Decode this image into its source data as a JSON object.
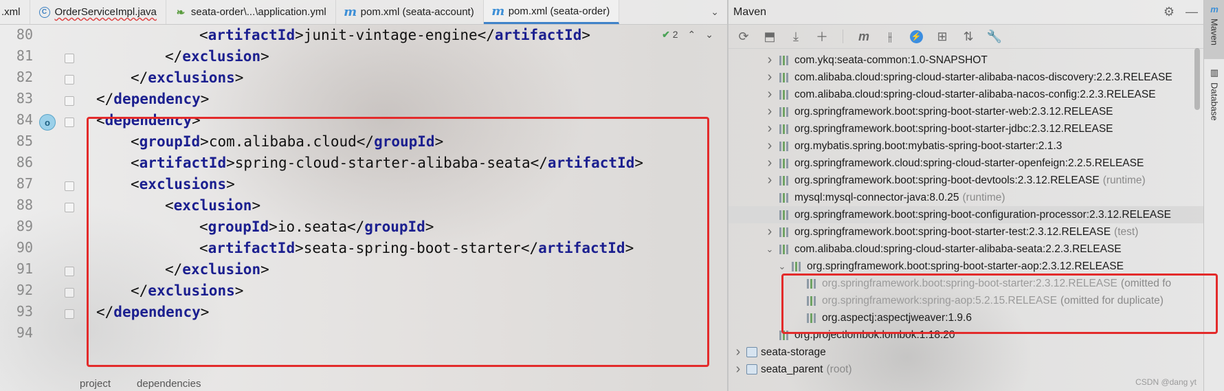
{
  "tabs": [
    {
      "label": ".xml",
      "icon": "none",
      "active": false
    },
    {
      "label": "OrderServiceImpl.java",
      "icon": "c",
      "active": false
    },
    {
      "label": "seata-order\\...\\application.yml",
      "icon": "leaf",
      "active": false
    },
    {
      "label": "pom.xml (seata-account)",
      "icon": "m",
      "active": false
    },
    {
      "label": "pom.xml (seata-order)",
      "icon": "m",
      "active": true
    }
  ],
  "editor": {
    "inspection_count": "2",
    "line_numbers": [
      "80",
      "81",
      "82",
      "83",
      "84",
      "85",
      "86",
      "87",
      "88",
      "89",
      "90",
      "91",
      "92",
      "93",
      "94"
    ],
    "lines": [
      {
        "indent": 3,
        "open": "<",
        "tag": "artifactId",
        "text": "junit-vintage-engine",
        "close": "artifactId"
      },
      {
        "indent": 2,
        "raw_prefix": "</",
        "tag": "exclusion",
        "raw_suffix": ">"
      },
      {
        "indent": 1,
        "raw_prefix": "</",
        "tag": "exclusions",
        "raw_suffix": ">"
      },
      {
        "indent": 0,
        "raw_prefix": "</",
        "tag": "dependency",
        "raw_suffix": ">"
      },
      {
        "indent": 0,
        "raw_prefix": "<",
        "tag": "dependency",
        "raw_suffix": ">"
      },
      {
        "indent": 1,
        "open": "<",
        "tag": "groupId",
        "text": "com.alibaba.cloud",
        "close": "groupId"
      },
      {
        "indent": 1,
        "open": "<",
        "tag": "artifactId",
        "text": "spring-cloud-starter-alibaba-seata",
        "close": "artifactId"
      },
      {
        "indent": 1,
        "raw_prefix": "<",
        "tag": "exclusions",
        "raw_suffix": ">"
      },
      {
        "indent": 2,
        "raw_prefix": "<",
        "tag": "exclusion",
        "raw_suffix": ">"
      },
      {
        "indent": 3,
        "open": "<",
        "tag": "groupId",
        "text": "io.seata",
        "close": "groupId"
      },
      {
        "indent": 3,
        "open": "<",
        "tag": "artifactId",
        "text": "seata-spring-boot-starter",
        "close": "artifactId"
      },
      {
        "indent": 2,
        "raw_prefix": "</",
        "tag": "exclusion",
        "raw_suffix": ">"
      },
      {
        "indent": 1,
        "raw_prefix": "</",
        "tag": "exclusions",
        "raw_suffix": ">"
      },
      {
        "indent": 0,
        "raw_prefix": "</",
        "tag": "dependency",
        "raw_suffix": ">"
      }
    ],
    "breadcrumb": [
      "project",
      "dependencies"
    ]
  },
  "maven": {
    "title": "Maven",
    "tree": [
      {
        "label": "com.ykq:seata-common:1.0-SNAPSHOT",
        "suffix": "",
        "level": 2,
        "arrow": "right",
        "icon": "lib"
      },
      {
        "label": "com.alibaba.cloud:spring-cloud-starter-alibaba-nacos-discovery:2.2.3.RELEASE",
        "suffix": "",
        "level": 2,
        "arrow": "right",
        "icon": "lib"
      },
      {
        "label": "com.alibaba.cloud:spring-cloud-starter-alibaba-nacos-config:2.2.3.RELEASE",
        "suffix": "",
        "level": 2,
        "arrow": "right",
        "icon": "lib"
      },
      {
        "label": "org.springframework.boot:spring-boot-starter-web:2.3.12.RELEASE",
        "suffix": "",
        "level": 2,
        "arrow": "right",
        "icon": "lib"
      },
      {
        "label": "org.springframework.boot:spring-boot-starter-jdbc:2.3.12.RELEASE",
        "suffix": "",
        "level": 2,
        "arrow": "right",
        "icon": "lib"
      },
      {
        "label": "org.mybatis.spring.boot:mybatis-spring-boot-starter:2.1.3",
        "suffix": "",
        "level": 2,
        "arrow": "right",
        "icon": "lib"
      },
      {
        "label": "org.springframework.cloud:spring-cloud-starter-openfeign:2.2.5.RELEASE",
        "suffix": "",
        "level": 2,
        "arrow": "right",
        "icon": "lib"
      },
      {
        "label": "org.springframework.boot:spring-boot-devtools:2.3.12.RELEASE",
        "suffix": "(runtime)",
        "level": 2,
        "arrow": "right",
        "icon": "lib"
      },
      {
        "label": "mysql:mysql-connector-java:8.0.25",
        "suffix": "(runtime)",
        "level": 2,
        "arrow": "none",
        "icon": "lib"
      },
      {
        "label": "org.springframework.boot:spring-boot-configuration-processor:2.3.12.RELEASE",
        "suffix": "",
        "level": 2,
        "arrow": "none",
        "icon": "lib",
        "selected": true
      },
      {
        "label": "org.springframework.boot:spring-boot-starter-test:2.3.12.RELEASE",
        "suffix": "(test)",
        "level": 2,
        "arrow": "right",
        "icon": "lib"
      },
      {
        "label": "com.alibaba.cloud:spring-cloud-starter-alibaba-seata:2.2.3.RELEASE",
        "suffix": "",
        "level": 2,
        "arrow": "down",
        "icon": "lib"
      },
      {
        "label": "org.springframework.boot:spring-boot-starter-aop:2.3.12.RELEASE",
        "suffix": "",
        "level": 3,
        "arrow": "down",
        "icon": "lib"
      },
      {
        "label": "org.springframework.boot:spring-boot-starter:2.3.12.RELEASE",
        "suffix": "(omitted fo",
        "level": 4,
        "arrow": "none",
        "icon": "lib",
        "faded": true
      },
      {
        "label": "org.springframework:spring-aop:5.2.15.RELEASE",
        "suffix": "(omitted for duplicate)",
        "level": 4,
        "arrow": "none",
        "icon": "lib",
        "faded": true
      },
      {
        "label": "org.aspectj:aspectjweaver:1.9.6",
        "suffix": "",
        "level": 4,
        "arrow": "none",
        "icon": "lib"
      },
      {
        "label": "org.projectlombok:lombok:1.18.20",
        "suffix": "",
        "level": 2,
        "arrow": "none",
        "icon": "lib"
      },
      {
        "label": "seata-storage",
        "suffix": "",
        "level": 0,
        "arrow": "right",
        "icon": "module"
      },
      {
        "label": "seata_parent",
        "suffix": "(root)",
        "level": 0,
        "arrow": "right",
        "icon": "module"
      }
    ]
  },
  "side_tabs": [
    "Maven",
    "Database"
  ],
  "watermark": "CSDN @dang yt",
  "colors": {
    "highlight_box": "#e32b2b",
    "tag": "#1b1f8f",
    "active_tab": "#4083c9"
  }
}
